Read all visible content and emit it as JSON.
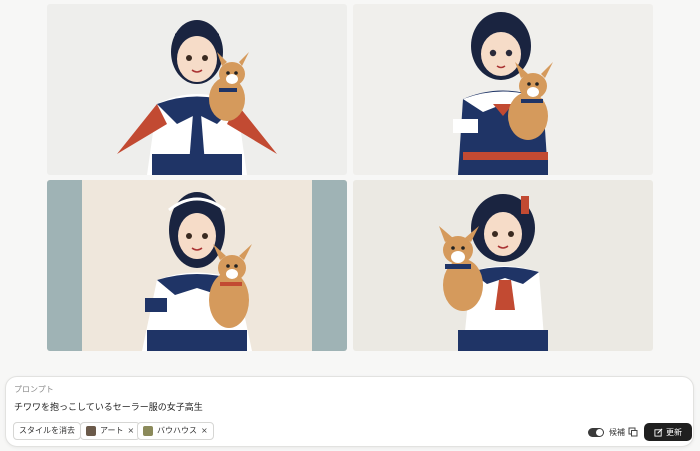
{
  "images": [
    {
      "name": "generated-image-1",
      "bg": "#eeeeec"
    },
    {
      "name": "generated-image-2",
      "bg": "#f0efec"
    },
    {
      "name": "generated-image-3",
      "bg": "#efe7dc",
      "side": "#9fb3b5"
    },
    {
      "name": "generated-image-4",
      "bg": "#ebe9e3"
    }
  ],
  "prompt": {
    "label": "プロンプト",
    "text": "チワワを抱っこしているセーラー服の女子高生"
  },
  "chips": {
    "clear": "スタイルを消去",
    "art": "アート",
    "bauhaus": "バウハウス",
    "remove": "×"
  },
  "controls": {
    "candidates": "候補",
    "update": "更新"
  },
  "colors": {
    "navy": "#1f3466",
    "red": "#c24a32",
    "skin": "#f6dcc8",
    "dog": "#d59a5c"
  }
}
